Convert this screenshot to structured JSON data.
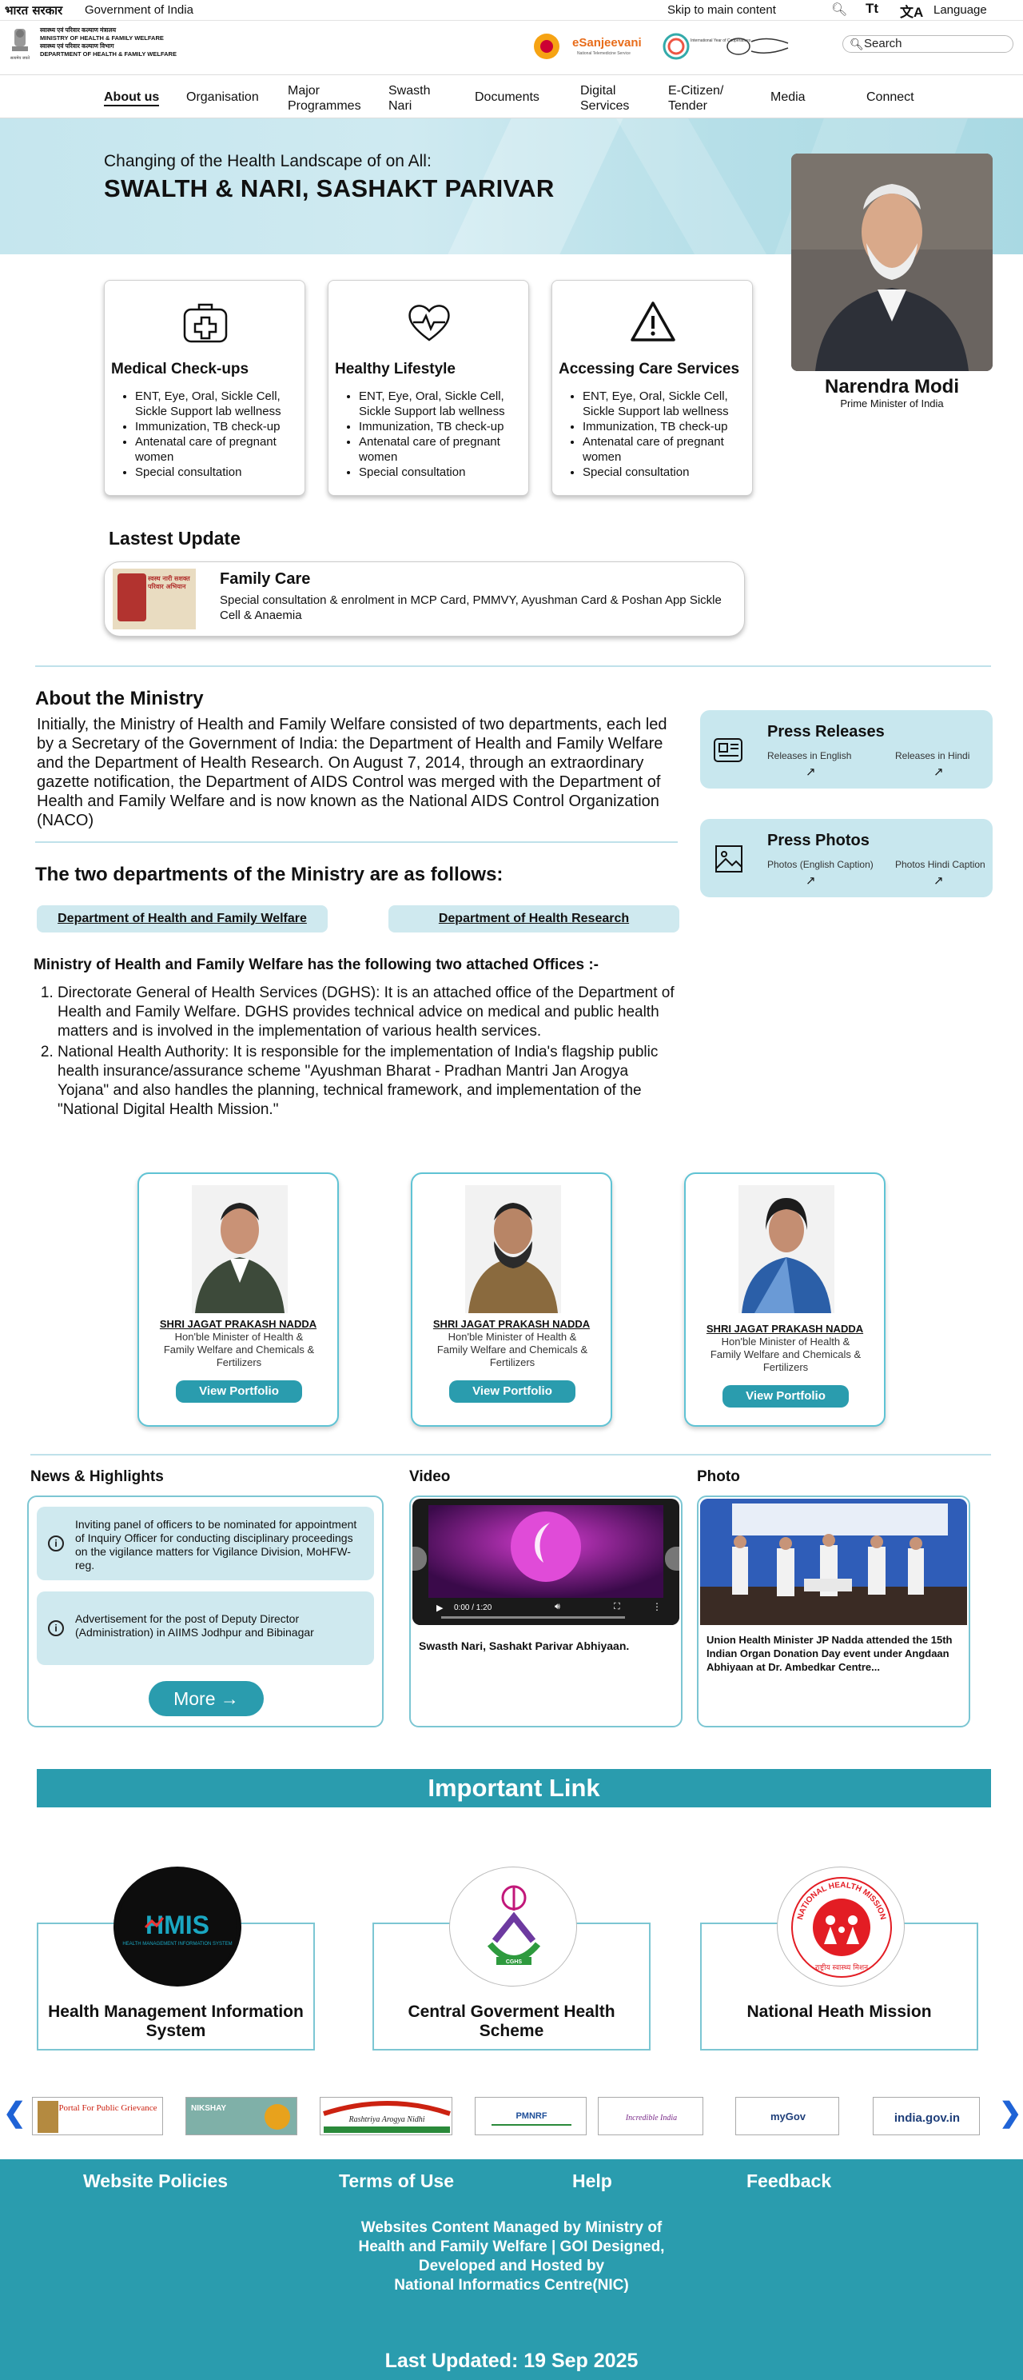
{
  "topbar": {
    "bharat_sarkar": "भारत सरकार",
    "goi": "Government of India",
    "skip": "Skip to main content",
    "text_size": "Tt",
    "language_icon": "translate-icon",
    "language": "Language"
  },
  "header": {
    "ministry_lines": [
      "स्वास्थ्य एवं परिवार कल्याण मंत्रालय",
      "MINISTRY OF HEALTH & FAMILY WELFARE",
      "स्वास्थ्य एवं परिवार कल्याण विभाग",
      "DEPARTMENT OF HEALTH & FAMILY WELFARE"
    ],
    "emblem_caption": "सत्यमेव जयते",
    "logo_esanjeevani": "eSanjeevani",
    "logo_esanjeevani_sub": "National Telemedicine Service",
    "logo_iyc": "International Year of Cooperatives",
    "search_placeholder": "Search"
  },
  "nav": {
    "items": [
      {
        "label": "About us"
      },
      {
        "label": "Organisation"
      },
      {
        "label": "Major Programmes"
      },
      {
        "label": "Swasth Nari"
      },
      {
        "label": "Documents"
      },
      {
        "label": "Digital Services"
      },
      {
        "label": "E-Citizen/ Tender"
      },
      {
        "label": "Media"
      },
      {
        "label": "Connect"
      }
    ]
  },
  "hero": {
    "subtitle": "Changing of the Health Landscape of on All:",
    "title": "SWALTH & NARI, SASHAKT PARIVAR",
    "pm_name": "Narendra Modi",
    "pm_role": "Prime Minister of India"
  },
  "cards": [
    {
      "title": "Medical Check-ups",
      "icon": "first-aid-kit-icon",
      "items": [
        "ENT, Eye, Oral, Sickle Cell, Sickle Support lab wellness",
        "Immunization, TB check-up",
        "Antenatal care of pregnant women",
        "Special consultation"
      ]
    },
    {
      "title": "Healthy Lifestyle",
      "icon": "heartbeat-icon",
      "items": [
        "ENT, Eye, Oral, Sickle Cell, Sickle Support lab wellness",
        "Immunization, TB check-up",
        "Antenatal care of pregnant women",
        "Special consultation"
      ]
    },
    {
      "title": "Accessing Care Services",
      "icon": "warning-icon",
      "items": [
        "ENT, Eye, Oral, Sickle Cell, Sickle Support lab wellness",
        "Immunization, TB check-up",
        "Antenatal care of pregnant women",
        "Special consultation"
      ]
    }
  ],
  "latest": {
    "heading": "Lastest Update",
    "image_text": "स्वस्थ नारी सशक्त परिवार अभियान",
    "title": "Family Care",
    "desc": "Special consultation & enrolment in MCP Card, PMMVY, Ayushman Card & Poshan App Sickle Cell & Anaemia"
  },
  "about": {
    "heading": "About the Ministry",
    "text": "Initially, the Ministry of Health and Family Welfare consisted of two departments, each led by a Secretary of the Government of India: the Department of Health and Family Welfare and the Department of Health Research. On August 7, 2014, through an extraordinary gazette notification, the Department of AIDS Control was merged with the Department of Health and Family Welfare and is now known as the National AIDS Control Organization (NACO)"
  },
  "press": [
    {
      "title": "Press Releases",
      "icon": "newspaper-icon",
      "link1": "Releases in English",
      "link2": "Releases in Hindi"
    },
    {
      "title": "Press Photos",
      "icon": "image-icon",
      "link1": "Photos (English Caption)",
      "link2": "Photos Hindi Caption"
    }
  ],
  "departments": {
    "heading": "The two departments of the Ministry are as follows:",
    "items": [
      "Department of Health and Family Welfare",
      "Department of Health Research"
    ]
  },
  "attached": {
    "heading": "Ministry of Health and Family Welfare has the following two attached Offices :-",
    "items": [
      "Directorate General of Health Services (DGHS): It is an attached office of the Department of Health and Family Welfare. DGHS provides technical advice on medical and public health matters and is involved in the implementation of various health services.",
      "National Health Authority: It is responsible for the implementation of India's flagship public health insurance/assurance scheme \"Ayushman Bharat - Pradhan Mantri Jan Arogya Yojana\" and also handles the planning, technical framework, and implementation of the \"National Digital Health Mission.\""
    ]
  },
  "ministers": [
    {
      "name": "SHRI JAGAT PRAKASH NADDA",
      "role": "Hon'ble Minister of Health & Family Welfare and Chemicals & Fertilizers",
      "button": "View Portfolio"
    },
    {
      "name": "SHRI JAGAT PRAKASH NADDA",
      "role": "Hon'ble Minister of Health & Family Welfare and Chemicals & Fertilizers",
      "button": "View Portfolio"
    },
    {
      "name": "SHRI JAGAT PRAKASH NADDA",
      "role": "Hon'ble Minister of Health & Family Welfare and Chemicals & Fertilizers",
      "button": "View Portfolio"
    }
  ],
  "news": {
    "heading": "News & Highlights",
    "items": [
      "Inviting panel of officers to be nominated for appointment of Inquiry Officer for conducting disciplinary proceedings on the vigilance matters for Vigilance Division, MoHFW-reg.",
      "Advertisement for the post of Deputy Director (Administration) in AIIMS Jodhpur and Bibinagar"
    ],
    "more": "More"
  },
  "video": {
    "heading": "Video",
    "time": "0:00 / 1:20",
    "caption": "Swasth Nari, Sashakt Parivar Abhiyaan."
  },
  "photo": {
    "heading": "Photo",
    "caption": "Union Health Minister JP Nadda attended the 15th Indian Organ Donation Day event under Angdaan Abhiyaan at Dr. Ambedkar Centre..."
  },
  "important": {
    "heading": "Important Link",
    "items": [
      {
        "name": "Health Management Information System",
        "logo_text": "HMIS",
        "logo_sub": "HEALTH MANAGEMENT INFORMATION SYSTEM"
      },
      {
        "name": "Central Goverment Health Scheme",
        "logo_text": "CGHS"
      },
      {
        "name": "National Heath Mission",
        "logo_text": "NATIONAL HEALTH MISSION",
        "logo_sub": "राष्ट्रीय स्वास्थ्य मिशन"
      }
    ]
  },
  "carousel": {
    "logos": [
      "Portal For Public Grievance",
      "NIKSHAY",
      "Rashtriya Arogya Nidhi",
      "PMNRF",
      "Incredible India",
      "myGov",
      "india.gov.in"
    ]
  },
  "footer": {
    "links": [
      "Website Policies",
      "Terms of Use",
      "Help",
      "Feedback"
    ],
    "managed": "Websites Content Managed by Ministry of Health and Family Welfare | GOI Designed, Developed and Hosted by",
    "nic": "National Informatics Centre(NIC)",
    "last_updated": "Last Updated: 19 Sep 2025"
  },
  "colors": {
    "accent": "#2a9cae",
    "light": "#cfe9ef",
    "border": "#7cc6d3",
    "carousel_arrow": "#1f63d6"
  }
}
